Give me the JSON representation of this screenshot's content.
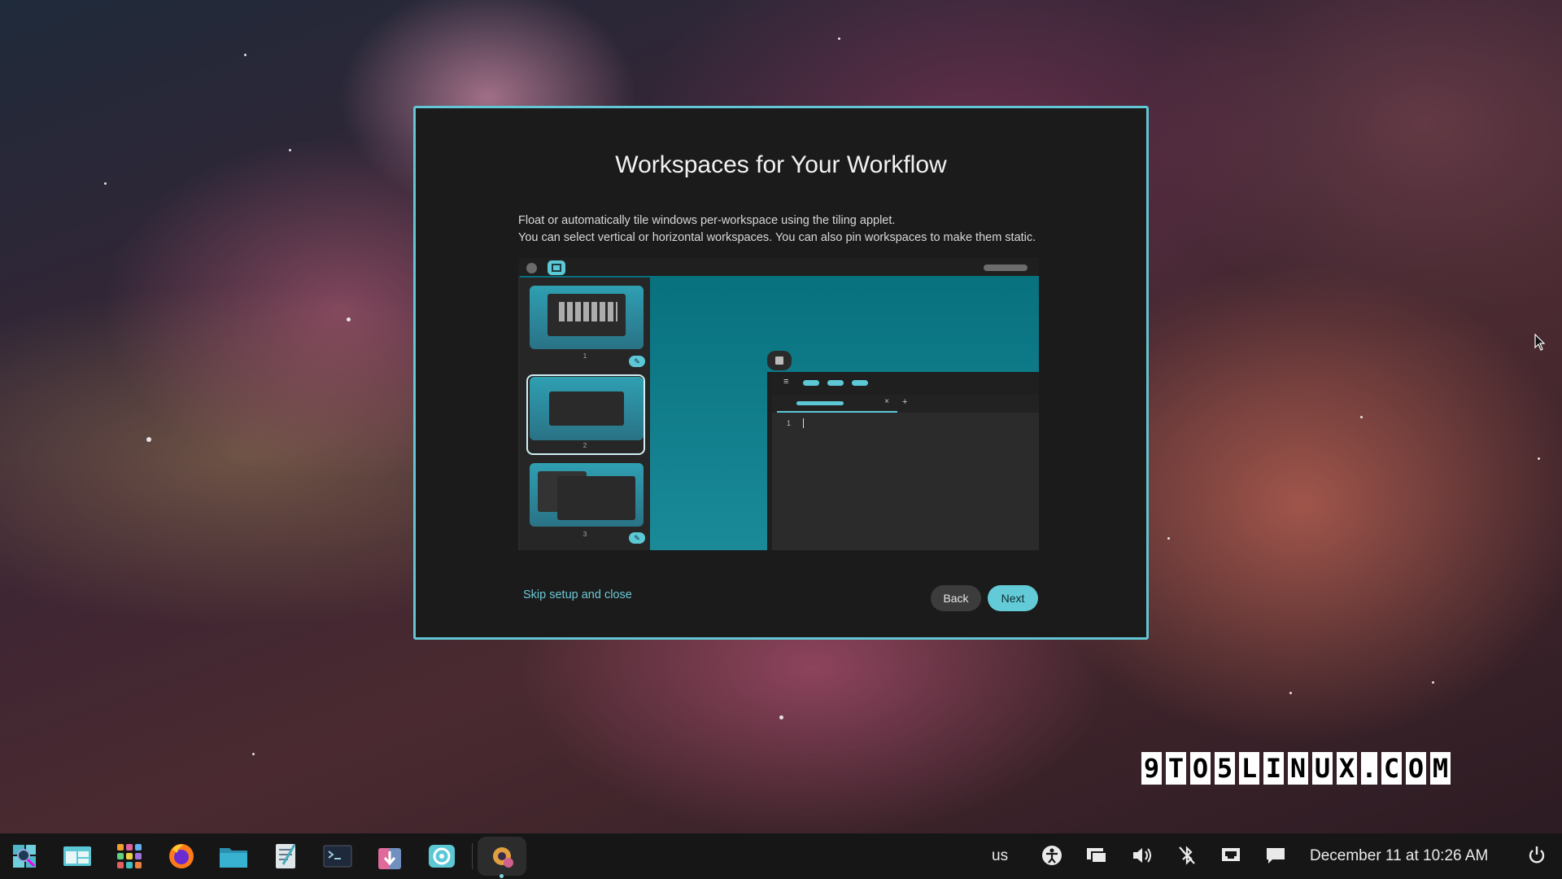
{
  "dialog": {
    "title": "Workspaces for Your Workflow",
    "description_line1": "Float or automatically tile windows per-workspace using the tiling applet.",
    "description_line2": "You can select vertical or horizontal workspaces. You can also pin workspaces to make them static.",
    "skip_label": "Skip setup and close",
    "back_label": "Back",
    "next_label": "Next"
  },
  "illustration": {
    "workspaces": [
      "1",
      "2",
      "3"
    ],
    "editor_line_number": "1"
  },
  "watermark": {
    "chars": [
      "9",
      "T",
      "O",
      "5",
      "L",
      "I",
      "N",
      "U",
      "X",
      ".",
      "C",
      "O",
      "M"
    ]
  },
  "taskbar": {
    "keyboard_layout": "us",
    "clock": "December 11 at 10:26 AM",
    "apps": [
      "launcher-icon",
      "workspaces-icon",
      "applications-icon",
      "firefox-icon",
      "files-icon",
      "text-editor-icon",
      "terminal-icon",
      "store-icon",
      "settings-icon",
      "initial-setup-icon"
    ]
  },
  "colors": {
    "accent": "#63cbd8",
    "dialog_bg": "#1b1b1b",
    "taskbar_bg": "#161616"
  }
}
